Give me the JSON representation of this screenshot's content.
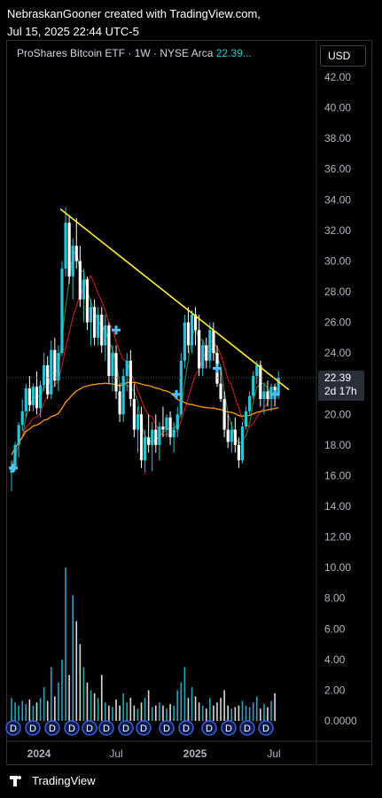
{
  "header": {
    "line1": "NebraskanGooner created with TradingView.com,",
    "line2": "Jul 15, 2025 22:44 UTC-5"
  },
  "legend": {
    "symbol": "ProShares Bitcoin ETF · 1W · NYSE Arca",
    "price": "22.39..."
  },
  "currency_button": "USD",
  "footer": {
    "brand": "TradingView"
  },
  "colors": {
    "up": "#26c6da",
    "down": "#ffffff",
    "trendline": "#ffeb3b",
    "ma_green": "#2e7d32",
    "ma_red": "#b71c1c",
    "ma_orange": "#ff9800",
    "price_tag": "#2a2e39"
  },
  "chart_data": {
    "type": "candlestick",
    "interval": "1W",
    "x_tick_labels": [
      "2024",
      "Jul",
      "2025",
      "Jul"
    ],
    "y_tick_labels": [
      "42.00",
      "40.00",
      "38.00",
      "36.00",
      "34.00",
      "32.00",
      "30.00",
      "28.00",
      "26.00",
      "24.00",
      "22.00",
      "20.00",
      "18.00",
      "16.00",
      "14.00",
      "12.00",
      "10.00",
      "8.00",
      "6.00",
      "4.00",
      "2.00",
      "0.0000"
    ],
    "y_range": [
      0,
      42
    ],
    "last_price_label": "22.39",
    "countdown_label": "2d 17h",
    "dividend_marker_label": "D",
    "dividend_marker_count": 14,
    "trendline": {
      "start": {
        "week": 10,
        "price": 33.4
      },
      "end": {
        "week": 137,
        "price": 21.6
      }
    },
    "candles": [
      {
        "o": 16.2,
        "h": 17.0,
        "l": 15.0,
        "c": 16.6
      },
      {
        "o": 16.6,
        "h": 18.2,
        "l": 16.3,
        "c": 18.0
      },
      {
        "o": 18.0,
        "h": 19.5,
        "l": 17.2,
        "c": 19.3
      },
      {
        "o": 19.3,
        "h": 21.0,
        "l": 18.9,
        "c": 20.2
      },
      {
        "o": 20.2,
        "h": 22.0,
        "l": 19.8,
        "c": 21.7
      },
      {
        "o": 21.7,
        "h": 22.5,
        "l": 20.2,
        "c": 20.6
      },
      {
        "o": 20.6,
        "h": 22.0,
        "l": 20.2,
        "c": 21.8
      },
      {
        "o": 21.8,
        "h": 22.8,
        "l": 20.0,
        "c": 20.4
      },
      {
        "o": 20.4,
        "h": 22.2,
        "l": 19.8,
        "c": 21.9
      },
      {
        "o": 21.9,
        "h": 24.0,
        "l": 21.5,
        "c": 23.2
      },
      {
        "o": 23.2,
        "h": 23.8,
        "l": 21.0,
        "c": 21.3
      },
      {
        "o": 21.3,
        "h": 24.8,
        "l": 21.0,
        "c": 24.2
      },
      {
        "o": 24.2,
        "h": 25.0,
        "l": 21.8,
        "c": 22.2
      },
      {
        "o": 22.2,
        "h": 24.5,
        "l": 21.5,
        "c": 24.0
      },
      {
        "o": 24.0,
        "h": 30.0,
        "l": 23.8,
        "c": 29.5
      },
      {
        "o": 29.5,
        "h": 33.5,
        "l": 29.0,
        "c": 32.5
      },
      {
        "o": 32.5,
        "h": 33.0,
        "l": 28.5,
        "c": 29.0
      },
      {
        "o": 29.0,
        "h": 31.5,
        "l": 27.5,
        "c": 31.0
      },
      {
        "o": 31.0,
        "h": 32.8,
        "l": 29.5,
        "c": 30.0
      },
      {
        "o": 30.0,
        "h": 31.0,
        "l": 27.0,
        "c": 27.5
      },
      {
        "o": 27.5,
        "h": 29.5,
        "l": 26.0,
        "c": 28.8
      },
      {
        "o": 28.8,
        "h": 29.0,
        "l": 25.5,
        "c": 26.0
      },
      {
        "o": 26.0,
        "h": 27.5,
        "l": 24.5,
        "c": 27.0
      },
      {
        "o": 27.0,
        "h": 27.5,
        "l": 24.5,
        "c": 25.0
      },
      {
        "o": 25.0,
        "h": 27.0,
        "l": 24.5,
        "c": 26.5
      },
      {
        "o": 26.5,
        "h": 27.0,
        "l": 24.0,
        "c": 24.5
      },
      {
        "o": 24.5,
        "h": 26.5,
        "l": 23.5,
        "c": 25.8
      },
      {
        "o": 25.8,
        "h": 26.0,
        "l": 22.0,
        "c": 22.5
      },
      {
        "o": 22.5,
        "h": 24.5,
        "l": 21.5,
        "c": 24.0
      },
      {
        "o": 24.0,
        "h": 24.5,
        "l": 21.0,
        "c": 21.5
      },
      {
        "o": 21.5,
        "h": 22.0,
        "l": 19.5,
        "c": 20.0
      },
      {
        "o": 20.0,
        "h": 23.0,
        "l": 19.5,
        "c": 22.5
      },
      {
        "o": 22.5,
        "h": 24.0,
        "l": 21.5,
        "c": 23.5
      },
      {
        "o": 23.5,
        "h": 24.2,
        "l": 20.5,
        "c": 21.0
      },
      {
        "o": 21.0,
        "h": 22.0,
        "l": 18.5,
        "c": 19.0
      },
      {
        "o": 19.0,
        "h": 20.5,
        "l": 17.5,
        "c": 20.0
      },
      {
        "o": 20.0,
        "h": 20.5,
        "l": 16.5,
        "c": 17.0
      },
      {
        "o": 17.0,
        "h": 19.0,
        "l": 16.2,
        "c": 18.5
      },
      {
        "o": 18.5,
        "h": 20.0,
        "l": 17.5,
        "c": 18.0
      },
      {
        "o": 18.0,
        "h": 19.5,
        "l": 16.3,
        "c": 19.0
      },
      {
        "o": 19.0,
        "h": 20.0,
        "l": 17.5,
        "c": 18.0
      },
      {
        "o": 18.0,
        "h": 19.5,
        "l": 17.0,
        "c": 19.2
      },
      {
        "o": 19.2,
        "h": 20.5,
        "l": 18.5,
        "c": 19.0
      },
      {
        "o": 19.0,
        "h": 20.0,
        "l": 18.5,
        "c": 19.8
      },
      {
        "o": 19.8,
        "h": 20.2,
        "l": 18.0,
        "c": 18.5
      },
      {
        "o": 18.5,
        "h": 19.5,
        "l": 17.5,
        "c": 19.0
      },
      {
        "o": 19.0,
        "h": 20.5,
        "l": 18.5,
        "c": 20.0
      },
      {
        "o": 20.0,
        "h": 24.0,
        "l": 19.8,
        "c": 23.5
      },
      {
        "o": 23.5,
        "h": 26.5,
        "l": 23.0,
        "c": 26.0
      },
      {
        "o": 26.0,
        "h": 27.0,
        "l": 24.0,
        "c": 24.5
      },
      {
        "o": 24.5,
        "h": 26.8,
        "l": 24.0,
        "c": 26.5
      },
      {
        "o": 26.5,
        "h": 27.0,
        "l": 24.5,
        "c": 25.5
      },
      {
        "o": 25.5,
        "h": 26.5,
        "l": 22.5,
        "c": 23.0
      },
      {
        "o": 23.0,
        "h": 24.8,
        "l": 22.5,
        "c": 24.5
      },
      {
        "o": 24.5,
        "h": 25.0,
        "l": 23.0,
        "c": 23.5
      },
      {
        "o": 23.5,
        "h": 26.0,
        "l": 23.0,
        "c": 25.5
      },
      {
        "o": 25.5,
        "h": 26.0,
        "l": 23.5,
        "c": 24.0
      },
      {
        "o": 24.0,
        "h": 24.5,
        "l": 21.8,
        "c": 22.0
      },
      {
        "o": 22.0,
        "h": 23.0,
        "l": 20.8,
        "c": 21.0
      },
      {
        "o": 21.0,
        "h": 21.5,
        "l": 18.5,
        "c": 19.0
      },
      {
        "o": 19.0,
        "h": 20.0,
        "l": 17.8,
        "c": 18.2
      },
      {
        "o": 18.2,
        "h": 19.5,
        "l": 17.5,
        "c": 19.0
      },
      {
        "o": 19.0,
        "h": 19.8,
        "l": 17.5,
        "c": 18.0
      },
      {
        "o": 18.0,
        "h": 18.5,
        "l": 16.5,
        "c": 17.0
      },
      {
        "o": 17.0,
        "h": 19.5,
        "l": 16.8,
        "c": 19.2
      },
      {
        "o": 19.2,
        "h": 20.5,
        "l": 19.0,
        "c": 20.2
      },
      {
        "o": 20.2,
        "h": 21.5,
        "l": 20.0,
        "c": 21.2
      },
      {
        "o": 21.2,
        "h": 22.8,
        "l": 21.0,
        "c": 22.5
      },
      {
        "o": 22.5,
        "h": 23.5,
        "l": 22.0,
        "c": 23.2
      },
      {
        "o": 23.2,
        "h": 23.5,
        "l": 20.5,
        "c": 21.0
      },
      {
        "o": 21.0,
        "h": 22.0,
        "l": 20.0,
        "c": 21.5
      },
      {
        "o": 21.5,
        "h": 22.2,
        "l": 20.5,
        "c": 21.0
      },
      {
        "o": 21.0,
        "h": 22.0,
        "l": 20.2,
        "c": 21.8
      },
      {
        "o": 21.8,
        "h": 22.0,
        "l": 20.5,
        "c": 21.2
      },
      {
        "o": 21.2,
        "h": 22.8,
        "l": 21.0,
        "c": 22.39
      }
    ],
    "volume": [
      1.5,
      1.2,
      1.0,
      1.3,
      1.1,
      1.4,
      1.0,
      1.2,
      1.5,
      2.2,
      1.3,
      3.5,
      1.6,
      2.5,
      4.0,
      10.0,
      3.0,
      8.2,
      6.5,
      5.0,
      3.5,
      2.5,
      2.0,
      1.8,
      1.5,
      3.0,
      1.2,
      1.0,
      0.9,
      1.4,
      1.0,
      1.8,
      1.2,
      1.5,
      1.0,
      0.8,
      1.2,
      1.5,
      2.0,
      0.9,
      1.0,
      1.2,
      1.0,
      0.8,
      1.1,
      1.0,
      2.0,
      2.5,
      3.5,
      1.5,
      2.2,
      1.6,
      1.2,
      1.0,
      0.8,
      1.5,
      1.0,
      1.2,
      1.5,
      2.0,
      1.0,
      0.8,
      0.9,
      1.0,
      1.3,
      1.0,
      0.9,
      1.2,
      1.6,
      0.8,
      1.1,
      0.9,
      1.3,
      1.8
    ]
  }
}
